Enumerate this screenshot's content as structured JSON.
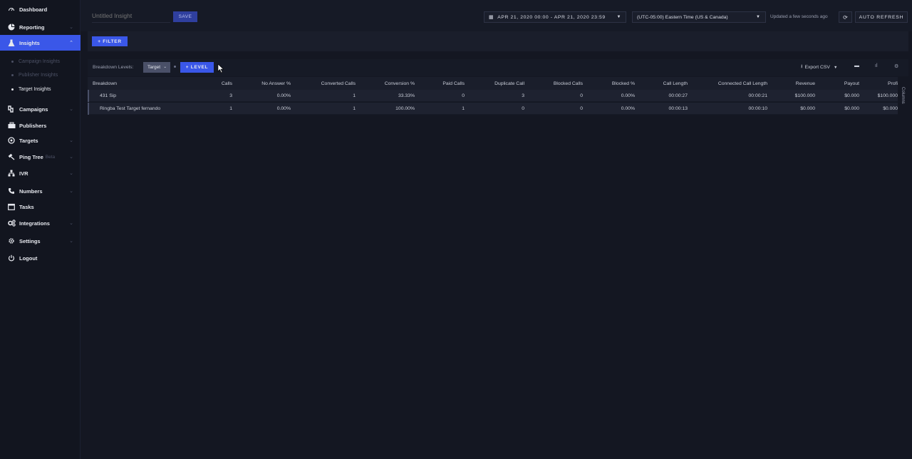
{
  "sidebar": {
    "items": [
      {
        "label": "Dashboard",
        "icon": "dashboard-icon"
      },
      {
        "label": "Reporting",
        "icon": "pie-chart-icon"
      },
      {
        "label": "Insights",
        "icon": "flask-icon"
      },
      {
        "label": "Campaigns",
        "icon": "campaigns-icon"
      },
      {
        "label": "Publishers",
        "icon": "publishers-icon"
      },
      {
        "label": "Targets",
        "icon": "target-icon"
      },
      {
        "label": "Ping Tree",
        "suffix": "Beta",
        "icon": "gavel-icon"
      },
      {
        "label": "IVR",
        "icon": "ivr-icon"
      },
      {
        "label": "Numbers",
        "icon": "phone-icon"
      },
      {
        "label": "Tasks",
        "icon": "calendar-icon"
      },
      {
        "label": "Integrations",
        "icon": "cogs-icon"
      },
      {
        "label": "Settings",
        "icon": "gear-icon"
      },
      {
        "label": "Logout",
        "icon": "power-icon"
      }
    ],
    "subitems": [
      {
        "label": "Campaign Insights"
      },
      {
        "label": "Publisher Insights"
      },
      {
        "label": "Target Insights"
      }
    ]
  },
  "header": {
    "insight_placeholder": "Untitled Insight",
    "save_label": "SAVE",
    "date_range": "APR 21, 2020 00:00 - APR 21, 2020 23:59",
    "timezone": "(UTC-05:00) Eastern Time (US & Canada)",
    "updated": "Updated a few seconds ago",
    "auto_refresh": "AUTO REFRESH"
  },
  "filter": {
    "label": "+ FILTER"
  },
  "breakdown": {
    "label": "Breakdown Levels:",
    "chip": "Target",
    "add_level": "+ LEVEL",
    "export": "Export CSV"
  },
  "table": {
    "columns": [
      "Breakdown",
      "Calls",
      "No Answer %",
      "Converted Calls",
      "Conversion %",
      "Paid Calls",
      "Duplicate Call",
      "Blocked Calls",
      "Blocked %",
      "Call Length",
      "Connected Call Length",
      "Revenue",
      "Payout",
      "Profi"
    ],
    "rows": [
      [
        "431 Sip",
        "3",
        "0.00%",
        "1",
        "33.33%",
        "0",
        "3",
        "0",
        "0.00%",
        "00:00:27",
        "00:00:21",
        "$100.000",
        "$0.000",
        "$100.000"
      ],
      [
        "Ringba Test Target fernando",
        "1",
        "0.00%",
        "1",
        "100.00%",
        "1",
        "0",
        "0",
        "0.00%",
        "00:00:13",
        "00:00:10",
        "$0.000",
        "$0.000",
        "$0.000"
      ]
    ],
    "columns_tab": "Columns"
  },
  "colors": {
    "accent": "#3a57e8",
    "background": "#141722",
    "sidebar": "#12151f"
  }
}
